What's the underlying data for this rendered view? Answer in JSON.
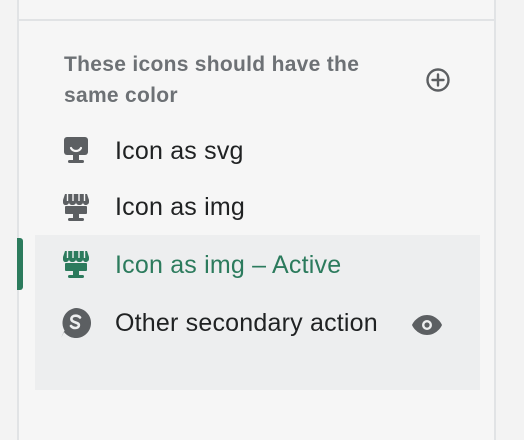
{
  "section": {
    "title": "These icons should have the same color",
    "action_icon": "circle-plus-icon"
  },
  "items": [
    {
      "label": "Icon as svg",
      "icon": "storefront-icon",
      "active": false
    },
    {
      "label": "Icon as img",
      "icon": "storefront-icon",
      "active": false
    },
    {
      "label": "Icon as img – Active",
      "icon": "storefront-icon",
      "active": true
    },
    {
      "label": "Other secondary action",
      "icon": "shopify-s-icon",
      "active": false,
      "secondary_action_icon": "eye-icon"
    }
  ],
  "colors": {
    "active": "#2c7b5d",
    "icon": "#5c5f62",
    "text": "#202223",
    "muted": "#6d7175"
  }
}
